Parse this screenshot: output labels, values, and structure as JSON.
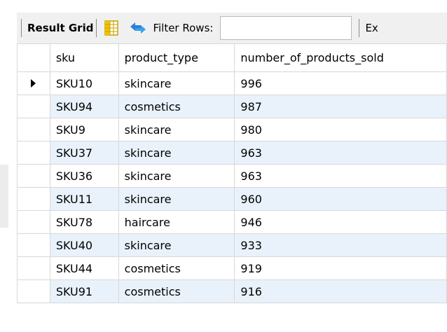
{
  "toolbar": {
    "result_grid_label": "Result Grid",
    "grid_icon": "grid-icon",
    "refresh_icon": "refresh-arrows-icon",
    "filter_label": "Filter Rows:",
    "filter_value": "",
    "filter_placeholder": "",
    "export_label": "Ex"
  },
  "table": {
    "columns": [
      "sku",
      "product_type",
      "number_of_products_sold"
    ],
    "selected_row_index": 0,
    "rows": [
      {
        "sku": "SKU10",
        "product_type": "skincare",
        "number_of_products_sold": "996"
      },
      {
        "sku": "SKU94",
        "product_type": "cosmetics",
        "number_of_products_sold": "987"
      },
      {
        "sku": "SKU9",
        "product_type": "skincare",
        "number_of_products_sold": "980"
      },
      {
        "sku": "SKU37",
        "product_type": "skincare",
        "number_of_products_sold": "963"
      },
      {
        "sku": "SKU36",
        "product_type": "skincare",
        "number_of_products_sold": "963"
      },
      {
        "sku": "SKU11",
        "product_type": "skincare",
        "number_of_products_sold": "960"
      },
      {
        "sku": "SKU78",
        "product_type": "haircare",
        "number_of_products_sold": "946"
      },
      {
        "sku": "SKU40",
        "product_type": "skincare",
        "number_of_products_sold": "933"
      },
      {
        "sku": "SKU44",
        "product_type": "cosmetics",
        "number_of_products_sold": "919"
      },
      {
        "sku": "SKU91",
        "product_type": "cosmetics",
        "number_of_products_sold": "916"
      }
    ]
  },
  "colors": {
    "toolbar_bg": "#f0f0f0",
    "alt_row_bg": "#e9f2fb",
    "grid_line": "#d8d8d8"
  }
}
